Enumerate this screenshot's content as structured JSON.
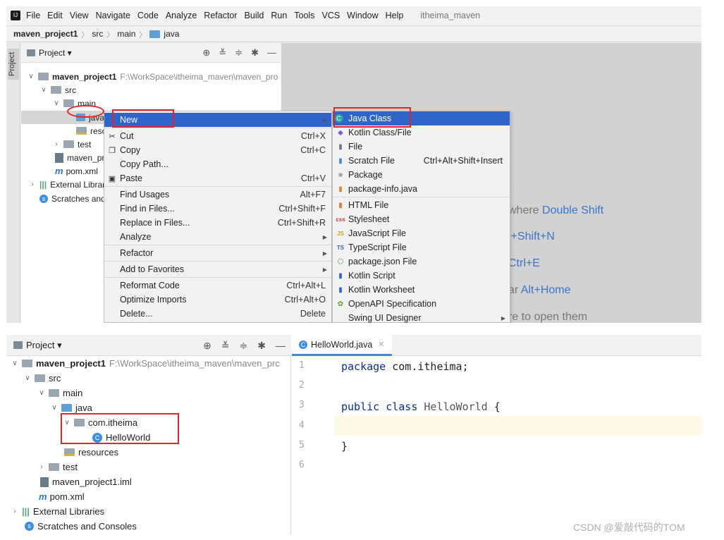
{
  "top": {
    "menu": [
      "File",
      "Edit",
      "View",
      "Navigate",
      "Code",
      "Analyze",
      "Refactor",
      "Build",
      "Run",
      "Tools",
      "VCS",
      "Window",
      "Help"
    ],
    "project_name": "itheima_maven",
    "breadcrumbs": [
      "maven_project1",
      "src",
      "main",
      "java"
    ],
    "side_tab": "Project",
    "panel_title": "Project ▾",
    "tree": {
      "root": "maven_project1",
      "root_path": "F:\\WorkSpace\\itheima_maven\\maven_pro",
      "src": "src",
      "main": "main",
      "java": "java",
      "resources": "reso",
      "test": "test",
      "iml": "maven_pro",
      "pom": "pom.xml",
      "ext": "External Librar",
      "scratches": "Scratches and"
    },
    "context_menu": {
      "new": "New",
      "cut": "Cut",
      "cut_key": "Ctrl+X",
      "copy": "Copy",
      "copy_key": "Ctrl+C",
      "copy_path": "Copy Path...",
      "paste": "Paste",
      "paste_key": "Ctrl+V",
      "find_usages": "Find Usages",
      "find_usages_key": "Alt+F7",
      "find_in_files": "Find in Files...",
      "find_in_files_key": "Ctrl+Shift+F",
      "replace_in_files": "Replace in Files...",
      "replace_in_files_key": "Ctrl+Shift+R",
      "analyze": "Analyze",
      "refactor": "Refactor",
      "add_favorites": "Add to Favorites",
      "reformat": "Reformat Code",
      "reformat_key": "Ctrl+Alt+L",
      "optimize": "Optimize Imports",
      "optimize_key": "Ctrl+Alt+O",
      "delete": "Delete...",
      "delete_key": "Delete"
    },
    "submenu": {
      "java_class": "Java Class",
      "kotlin_class": "Kotlin Class/File",
      "file": "File",
      "scratch": "Scratch File",
      "scratch_key": "Ctrl+Alt+Shift+Insert",
      "package": "Package",
      "package_info": "package-info.java",
      "html": "HTML File",
      "stylesheet": "Stylesheet",
      "js": "JavaScript File",
      "ts": "TypeScript File",
      "pkg_json": "package.json File",
      "kotlin_script": "Kotlin Script",
      "kotlin_worksheet": "Kotlin Worksheet",
      "openapi": "OpenAPI Specification",
      "swing": "Swing UI Designer"
    },
    "hints": {
      "h1_text": "where ",
      "h1_key": "Double Shift",
      "h2_key": "l+Shift+N",
      "h3_key": "Ctrl+E",
      "h4_text": "ar ",
      "h4_key": "Alt+Home",
      "h5_text": "re to open them"
    }
  },
  "bottom": {
    "panel_title": "Project ▾",
    "tree": {
      "root": "maven_project1",
      "root_path": "F:\\WorkSpace\\itheima_maven\\maven_prc",
      "src": "src",
      "main": "main",
      "java": "java",
      "package": "com.itheima",
      "class": "HelloWorld",
      "resources": "resources",
      "test": "test",
      "iml": "maven_project1.iml",
      "pom": "pom.xml",
      "ext": "External Libraries",
      "scratches": "Scratches and Consoles"
    },
    "tab": "HelloWorld.java",
    "lines": [
      "1",
      "2",
      "3",
      "4",
      "5",
      "6"
    ],
    "code": {
      "l1_kw": "package",
      "l1_rest": " com.itheima;",
      "l3_kw": "public class",
      "l3_name": " HelloWorld",
      "l3_brace": " {",
      "l5": "}"
    }
  },
  "watermark": "CSDN @爱敲代码的TOM"
}
